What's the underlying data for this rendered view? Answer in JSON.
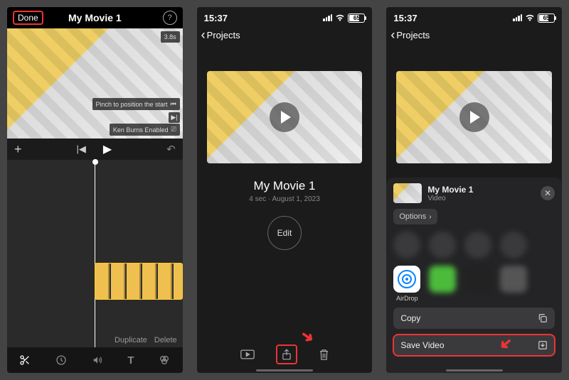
{
  "p1": {
    "done_label": "Done",
    "title": "My Movie 1",
    "duration_badge": "3.8s",
    "hint_pinch": "Pinch to position the start",
    "hint_kenburns": "Ken Burns Enabled",
    "action_duplicate": "Duplicate",
    "action_delete": "Delete"
  },
  "p2": {
    "time": "15:37",
    "battery": "65",
    "back_label": "Projects",
    "title": "My Movie 1",
    "subtitle": "4 sec · August 1, 2023",
    "edit_label": "Edit"
  },
  "p3": {
    "time": "15:37",
    "battery": "65",
    "back_label": "Projects",
    "sheet_title": "My Movie 1",
    "sheet_subtitle": "Video",
    "options_label": "Options",
    "airdrop_label": "AirDrop",
    "action_copy": "Copy",
    "action_save": "Save Video"
  }
}
